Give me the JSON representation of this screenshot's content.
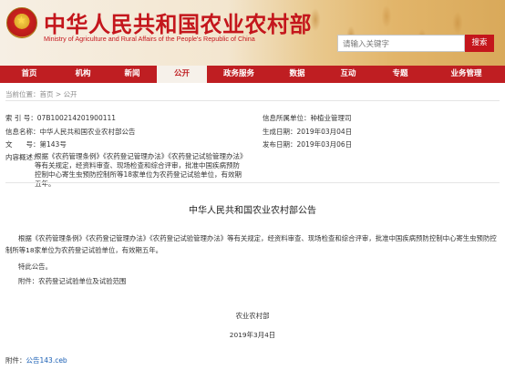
{
  "header": {
    "title_cn": "中华人民共和国农业农村部",
    "title_en": "Ministry of Agriculture and Rural Affairs of the People's Republic of China",
    "search_placeholder": "请输入关键字",
    "search_button": "搜索"
  },
  "nav": [
    {
      "label": "首页",
      "active": false
    },
    {
      "label": "机构",
      "active": false
    },
    {
      "label": "新闻",
      "active": false
    },
    {
      "label": "公开",
      "active": true
    },
    {
      "label": "政务服务",
      "active": false
    },
    {
      "label": "数据",
      "active": false
    },
    {
      "label": "互动",
      "active": false
    },
    {
      "label": "专题",
      "active": false
    },
    {
      "label": "业务管理",
      "active": false
    }
  ],
  "breadcrumb": {
    "prefix": "当前位置：",
    "home": "首页",
    "sep": " > ",
    "current": "公开"
  },
  "info": {
    "index_label": "索 引 号：",
    "index_value": "07B100214201900111",
    "source_label": "信息名称：",
    "source_value": "中华人民共和国农业农村部公告",
    "doc_label": "文　　号：",
    "doc_value": "第143号",
    "summary_label": "内容概述：",
    "summary_value": "根据《农药管理条例》《农药登记管理办法》《农药登记试验管理办法》等有关规定，经资料审查、现场检查和综合评审，批准中国疾病预防控制中心寄生虫预防控制所等18家单位为农药登记试验单位，有效期五年。",
    "dept_label": "信息所属单位：",
    "dept_value": "种植业管理司",
    "gen_label": "生成日期：",
    "gen_value": "2019年03月04日",
    "pub_label": "发布日期：",
    "pub_value": "2019年03月06日"
  },
  "document": {
    "title": "中华人民共和国农业农村部公告",
    "body": "根据《农药管理条例》《农药登记管理办法》《农药登记试验管理办法》等有关规定，经资料审查、现场检查和综合评审，批准中国疾病预防控制中心寄生虫预防控制所等18家单位为农药登记试验单位，有效期五年。",
    "announce": "特此公告。",
    "attachment_text": "附件：农药登记试验单位及试验范围",
    "org": "农业农村部",
    "date": "2019年3月4日"
  },
  "attachment": {
    "label": "附件：",
    "file": "公告143.ceb"
  }
}
